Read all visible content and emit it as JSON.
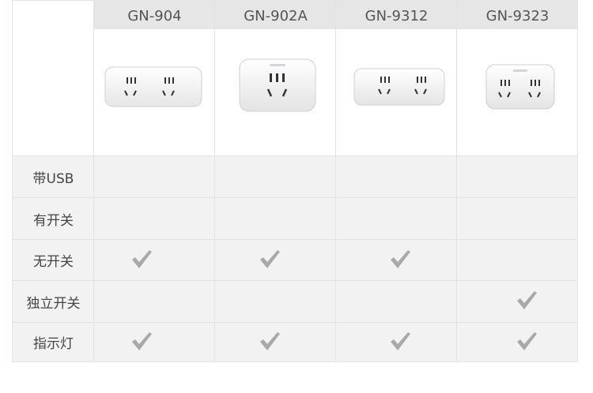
{
  "columns": [
    "GN-904",
    "GN-902A",
    "GN-9312",
    "GN-9323"
  ],
  "rows": [
    {
      "label": "带USB",
      "checks": [
        false,
        false,
        false,
        false
      ]
    },
    {
      "label": "有开关",
      "checks": [
        false,
        false,
        false,
        false
      ]
    },
    {
      "label": "无开关",
      "checks": [
        true,
        true,
        true,
        false
      ]
    },
    {
      "label": "独立开关",
      "checks": [
        false,
        false,
        false,
        true
      ]
    },
    {
      "label": "指示灯",
      "checks": [
        true,
        true,
        true,
        true
      ]
    }
  ],
  "icons": {
    "check": "check-icon",
    "product": "power-strip-image"
  },
  "colors": {
    "header_bg": "#e6e6e6",
    "row_bg": "#f2f2f2",
    "check": "#a9a9a9",
    "text": "#444444"
  }
}
